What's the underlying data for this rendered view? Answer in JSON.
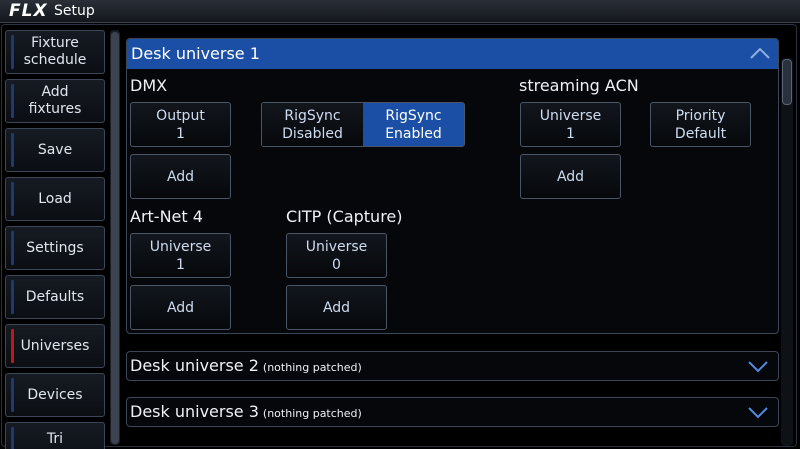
{
  "titlebar": {
    "logo": "FLX",
    "title": "Setup"
  },
  "nav": {
    "items": [
      {
        "line1": "Fixture",
        "line2": "schedule"
      },
      {
        "line1": "Add",
        "line2": "fixtures"
      },
      {
        "line1": "Save",
        "line2": ""
      },
      {
        "line1": "Load",
        "line2": ""
      },
      {
        "line1": "Settings",
        "line2": ""
      },
      {
        "line1": "Defaults",
        "line2": ""
      },
      {
        "line1": "Universes",
        "line2": ""
      },
      {
        "line1": "Devices",
        "line2": ""
      },
      {
        "line1": "Tri",
        "line2": ""
      }
    ],
    "active": "Universes"
  },
  "universe1": {
    "title": "Desk universe 1",
    "dmx": {
      "label": "DMX",
      "output": {
        "line1": "Output",
        "line2": "1"
      },
      "add": "Add",
      "rigsync": {
        "disabled": {
          "line1": "RigSync",
          "line2": "Disabled"
        },
        "enabled": {
          "line1": "RigSync",
          "line2": "Enabled"
        },
        "selected": "enabled"
      }
    },
    "sacn": {
      "label": "streaming ACN",
      "universe": {
        "line1": "Universe",
        "line2": "1"
      },
      "priority": {
        "line1": "Priority",
        "line2": "Default"
      },
      "add": "Add"
    },
    "artnet": {
      "label": "Art-Net 4",
      "universe": {
        "line1": "Universe",
        "line2": "1"
      },
      "add": "Add"
    },
    "citp": {
      "label": "CITP (Capture)",
      "universe": {
        "line1": "Universe",
        "line2": "0"
      },
      "add": "Add"
    }
  },
  "universe2": {
    "title": "Desk universe 2",
    "subtitle": "(nothing patched)"
  },
  "universe3": {
    "title": "Desk universe 3",
    "subtitle": "(nothing patched)"
  },
  "colors": {
    "accent": "#1b4fa5",
    "active_marker": "#c01818",
    "nav_marker": "#1f3a6e"
  }
}
